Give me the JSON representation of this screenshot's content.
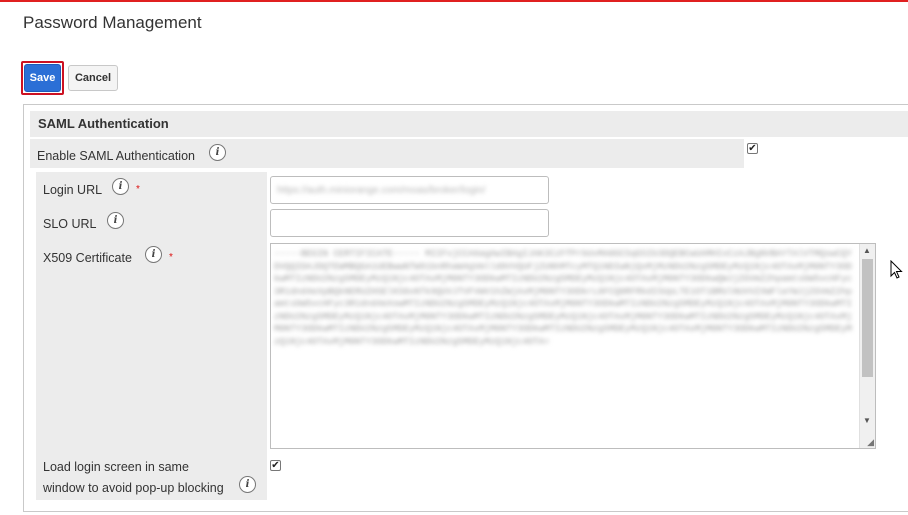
{
  "page": {
    "title": "Password Management"
  },
  "toolbar": {
    "save_label": "Save",
    "cancel_label": "Cancel"
  },
  "section": {
    "title": "SAML Authentication"
  },
  "enable_saml": {
    "label": "Enable SAML Authentication",
    "checked": true
  },
  "fields": {
    "login_url": {
      "label": "Login URL",
      "required_mark": "*",
      "value": "https://auth.miniorange.com/moas/broker/login/"
    },
    "slo_url": {
      "label": "SLO URL",
      "value": ""
    },
    "x509": {
      "label": "X509 Certificate",
      "required_mark": "*",
      "value": "-----BEGIN CERTIFICATE----- MIIFvjCCA6agAwIBAgIJAK3CzFfPrbUvMA0GCSqGSIb3DQEBCwUAMHIxCzAJBgNVBAYTAlVTMQswCQYDVQQIDAJDQTEWMBQGA1UEBwwNTW91bnRhaW4gVmlld0VVQUFjZUNhMTcyMTQ1NDIwNjQxMjMzNDU2Nzg5MDEyMzQ1Njc4OTAxMjM0NTY3ODkwMTIzNDU2Nzg5MDEyMzQ1Njc4OTAxMjM0NTY3ODkwMTIzNDU2Nzg5MDEyMzQ1Njc4OTAxMjM0NTY3ODkwQWJjZGVmZ2hpamtsbW5vcHFyc3R1dnd4eXpBQkNERUZHSElKS0xNTk9QUVJTVFVWV1hZWjAxMjM0NTY3ODkrL0FCQ0RFRkdISUpLTE1OT1BRUlNUVVZXWFlaYWJjZGVmZ2hpamtsbW5vcHFyc3R1dnd4eXowMTIzNDU2Nzg5MDEyMzQ1Njc4OTAxMjM0NTY3ODkwMTIzNDU2Nzg5MDEyMzQ1Njc4OTAxMjM0NTY3ODkwMTIzNDU2Nzg5MDEyMzQ1Njc4OTAxMjM0NTY3ODkwMTIzNDU2Nzg5MDEyMzQ1Njc4OTAxMjM0NTY3ODkwMTIzNDU2Nzg5MDEyMzQ1Njc4OTAxMjM0NTY3ODkwMTIzNDU2Nzg5MDEyMzQ1Njc4OTAxMjM0NTY3ODkwMTIzNDU2Nzg5MDEyMzQ1Njc4OTAxMjM0NTY3ODkwMTIzNDU2Nzg5MDEyMzQ1Njc4OTAxMjM0NTY3ODkwMTIzNDU2Nzg5MDEyMzQ1Njc4OTA="
    },
    "same_window": {
      "label_line1": "Load login screen in same",
      "label_line2": "window to avoid pop-up blocking",
      "checked": true
    }
  },
  "colors": {
    "accent": "#2b6fd6",
    "highlight": "#cc1122",
    "top_bar": "#e02020",
    "panel_bg": "#ececec"
  }
}
